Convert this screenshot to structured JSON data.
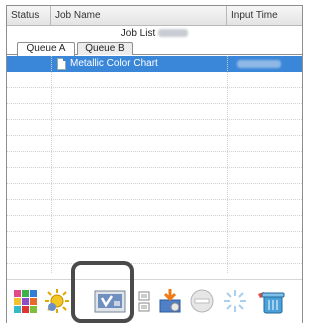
{
  "header": {
    "status_label": "Status",
    "job_name_label": "Job Name",
    "input_time_label": "Input Time"
  },
  "job_list": {
    "title": "Job List"
  },
  "tabs": [
    {
      "label": "Queue A",
      "active": true
    },
    {
      "label": "Queue B",
      "active": false
    }
  ],
  "jobs": [
    {
      "name": "Metallic Color Chart",
      "selected": true
    }
  ],
  "toolbar": {
    "buttons": [
      {
        "icon": "color-chart-icon"
      },
      {
        "icon": "sun-settings-icon"
      },
      {
        "icon": "print-verify-icon",
        "highlighted": true
      },
      {
        "icon": "document-small-icon"
      },
      {
        "icon": "print-output-icon"
      },
      {
        "icon": "minus-circle-icon"
      },
      {
        "icon": "sparkle-icon"
      },
      {
        "icon": "trash-icon"
      }
    ]
  },
  "colors": {
    "selection": "#3a86d9",
    "highlight_ring": "#4a4a4a"
  }
}
